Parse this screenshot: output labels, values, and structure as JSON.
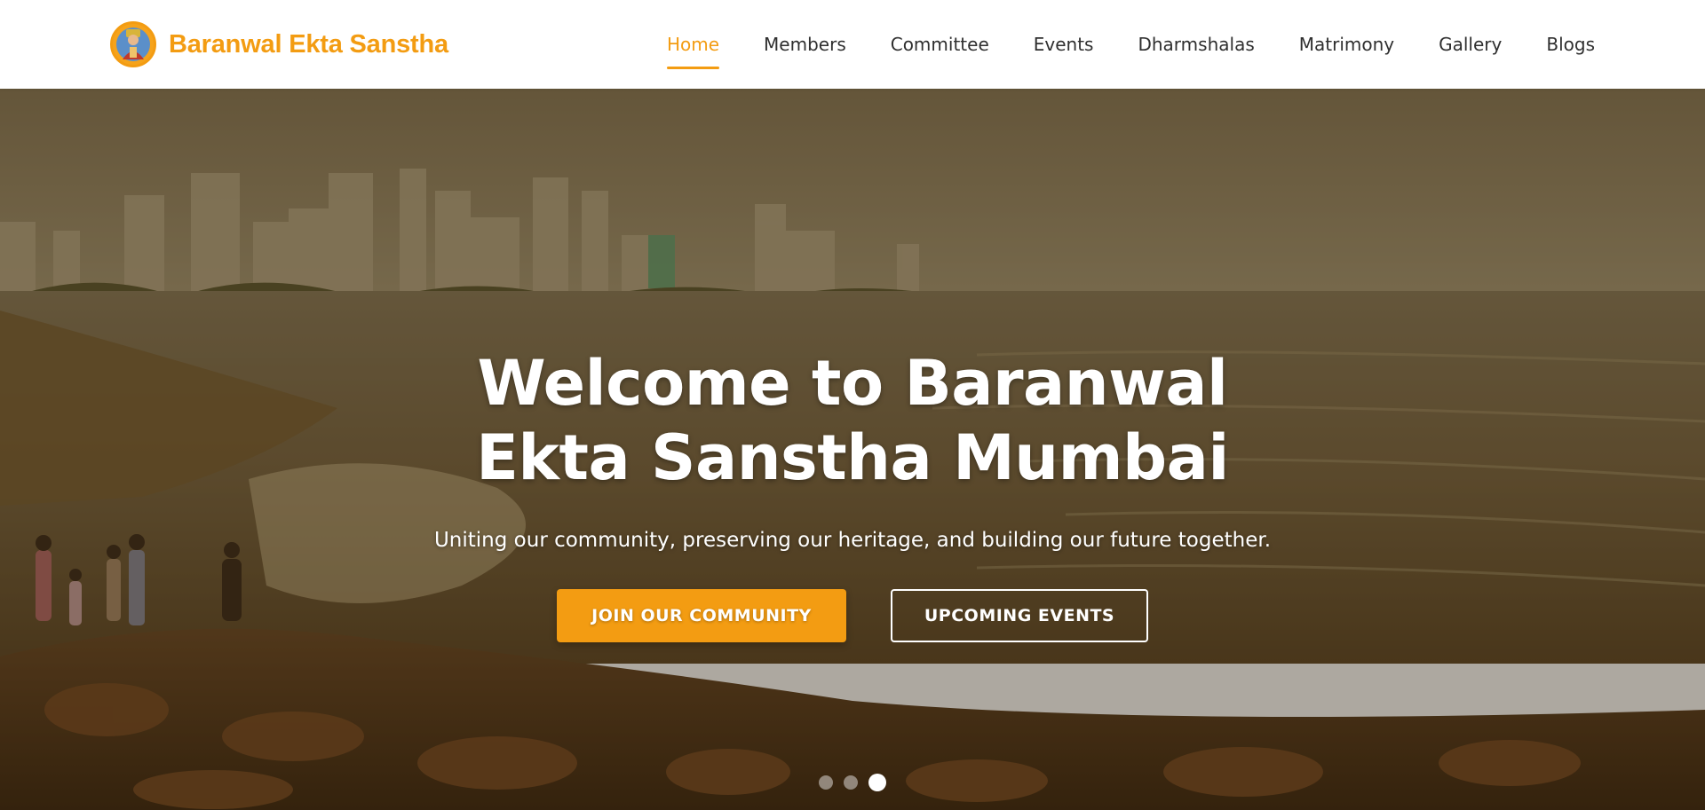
{
  "header": {
    "brand_name": "Baranwal Ekta Sanstha",
    "logo_icon": "emblem-portrait-icon",
    "nav": [
      {
        "label": "Home",
        "active": true
      },
      {
        "label": "Members",
        "active": false
      },
      {
        "label": "Committee",
        "active": false
      },
      {
        "label": "Events",
        "active": false
      },
      {
        "label": "Dharmshalas",
        "active": false
      },
      {
        "label": "Matrimony",
        "active": false
      },
      {
        "label": "Gallery",
        "active": false
      },
      {
        "label": "Blogs",
        "active": false
      }
    ]
  },
  "hero": {
    "title": "Welcome to Baranwal Ekta Sanstha Mumbai",
    "subtitle": "Uniting our community, preserving our heritage, and building our future together.",
    "primary_button": "JOIN OUR COMMUNITY",
    "secondary_button": "UPCOMING EVENTS",
    "slides_total": 3,
    "active_slide": 3
  },
  "colors": {
    "accent": "#f39c12",
    "nav_text": "#2f2f2f",
    "hero_text": "#ffffff"
  }
}
